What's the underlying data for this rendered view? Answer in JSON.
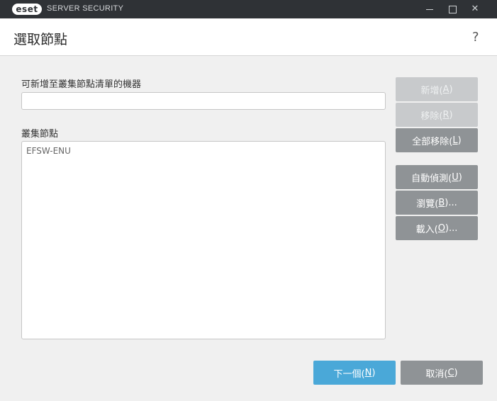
{
  "titlebar": {
    "logo_text": "eset",
    "product": "SERVER SECURITY"
  },
  "header": {
    "title": "選取節點",
    "help": "?"
  },
  "form": {
    "add_label": "可新增至叢集節點清單的機器",
    "add_value": "",
    "nodes_label": "叢集節點",
    "nodes": [
      "EFSW-ENU"
    ]
  },
  "buttons": {
    "add": {
      "text": "新增(",
      "key": "A",
      "end": ")"
    },
    "remove": {
      "text": "移除(",
      "key": "R",
      "end": ")"
    },
    "remove_all": {
      "text": "全部移除(",
      "key": "L",
      "end": ")"
    },
    "autodetect": {
      "text": "自動偵測(",
      "key": "U",
      "end": ")"
    },
    "browse": {
      "text": "瀏覽(",
      "key": "B",
      "end": ")..."
    },
    "load": {
      "text": "載入(",
      "key": "O",
      "end": ")..."
    },
    "next": {
      "text": "下一個(",
      "key": "N",
      "end": ")"
    },
    "cancel": {
      "text": "取消(",
      "key": "C",
      "end": ")"
    }
  },
  "colors": {
    "titlebar": "#2f3236",
    "primary": "#4aa8d8",
    "secondary": "#8f9396",
    "disabled": "#c8cacc"
  }
}
